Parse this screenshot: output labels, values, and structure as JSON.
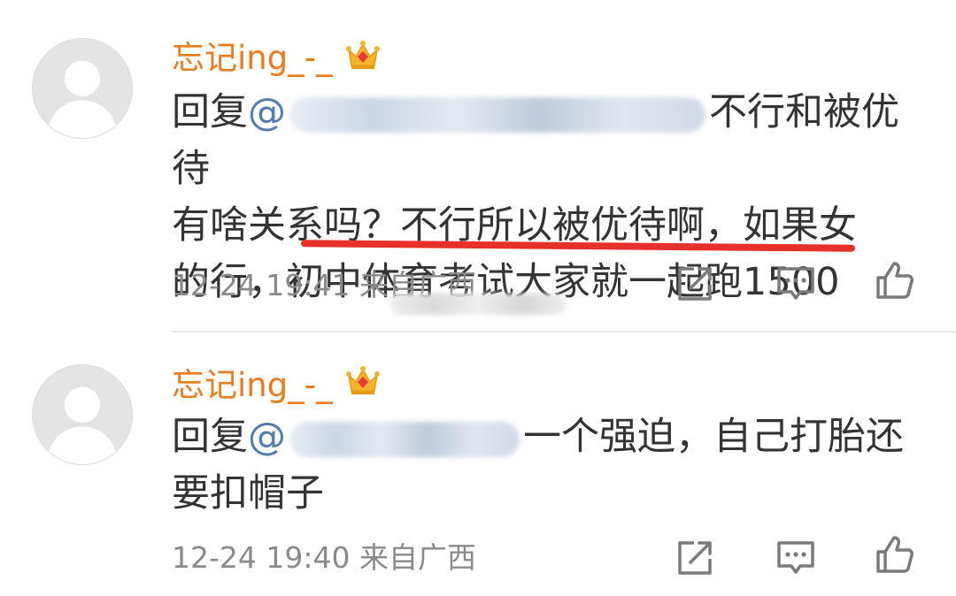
{
  "comments": [
    {
      "username": "忘记ing_-_",
      "reply_prefix": "回复",
      "mention_visible": "@",
      "text_line1": "不行和被优待",
      "text_line2": "有啥关系吗？不行所以被优待啊，如果女",
      "text_line3_a": "的行，",
      "text_line3_b": "初中体育考试大家就一起跑1500",
      "timestamp": "12-24 19:41",
      "location": "来自广西"
    },
    {
      "username": "忘记ing_-_",
      "reply_prefix": "回复",
      "mention_visible": "@",
      "text_line1": "一个强迫，自己打胎还",
      "text_line2": "要扣帽子",
      "timestamp": "12-24 19:40",
      "location": "来自广西"
    }
  ],
  "icons": {
    "badge": "crown-icon",
    "share": "share-icon",
    "comment": "comment-icon",
    "like": "thumbs-up-icon"
  },
  "colors": {
    "username": "#ec7b1c",
    "mention": "#507daf",
    "underline": "#e8302a",
    "meta": "#8a8a8a"
  }
}
